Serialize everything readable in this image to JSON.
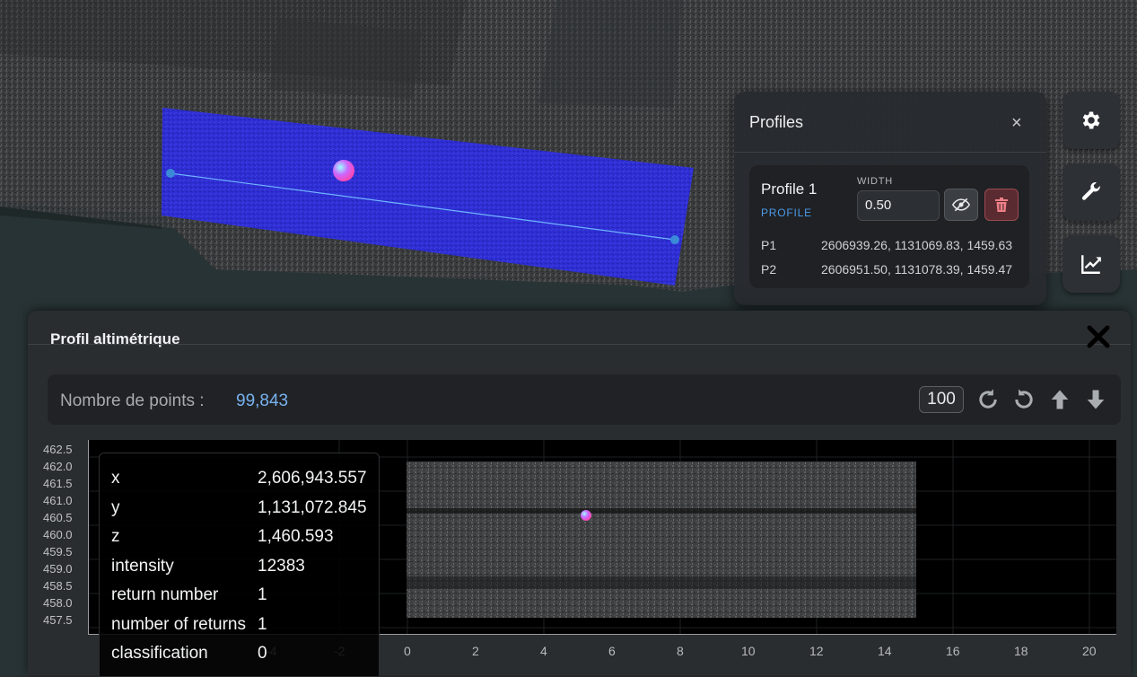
{
  "toolbar": {
    "buttons": [
      {
        "name": "settings",
        "icon": "gear-icon"
      },
      {
        "name": "tools",
        "icon": "wrench-icon"
      },
      {
        "name": "profile",
        "icon": "chart-line-icon"
      }
    ]
  },
  "profiles_panel": {
    "title": "Profiles",
    "close_label": "×",
    "profile": {
      "name": "Profile 1",
      "kind": "PROFILE",
      "width_label": "WIDTH",
      "width_value": "0.50",
      "p1_label": "P1",
      "p1_value": "2606939.26, 1131069.83, 1459.63",
      "p2_label": "P2",
      "p2_value": "2606951.50, 1131078.39, 1459.47"
    }
  },
  "profile_window": {
    "title": "Profil altimétrique",
    "points_label": "Nombre de points :",
    "points_value": "99,843",
    "percent": "100",
    "buttons": [
      "rotate-cw-icon",
      "rotate-ccw-icon",
      "arrow-up-icon",
      "arrow-down-icon"
    ]
  },
  "plot": {
    "y_ticks": [
      "462.5",
      "462.0",
      "461.5",
      "461.0",
      "460.5",
      "460.0",
      "459.5",
      "459.0",
      "458.5",
      "458.0",
      "457.5"
    ],
    "x_ticks": [
      "-4",
      "-2",
      "0",
      "2",
      "4",
      "6",
      "8",
      "10",
      "12",
      "14",
      "16",
      "18",
      "20"
    ]
  },
  "point_info": {
    "rows": [
      {
        "key": "x",
        "value": "2,606,943.557"
      },
      {
        "key": "y",
        "value": "1,131,072.845"
      },
      {
        "key": "z",
        "value": "1,460.593"
      },
      {
        "key": "intensity",
        "value": "12383"
      },
      {
        "key": "return number",
        "value": "1"
      },
      {
        "key": "number of returns",
        "value": "1"
      },
      {
        "key": "classification",
        "value": "0"
      }
    ]
  },
  "colors": {
    "accent": "#78b2ef",
    "selection": "#2a2ad8",
    "danger": "#e06a72"
  }
}
